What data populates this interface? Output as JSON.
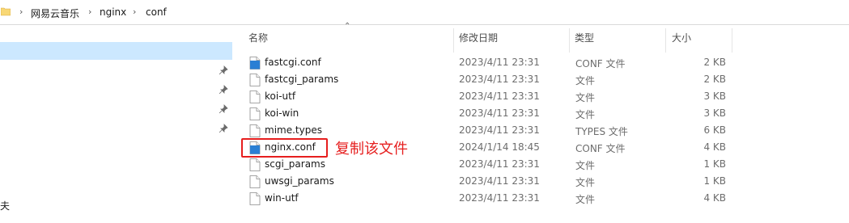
{
  "breadcrumb": {
    "items": [
      "网易云音乐",
      "nginx",
      "conf"
    ]
  },
  "nav": {
    "partial_label": "夫"
  },
  "columns": {
    "name": "名称",
    "modified": "修改日期",
    "type": "类型",
    "size": "大小"
  },
  "files": [
    {
      "name": "fastcgi.conf",
      "modified": "2023/4/11 23:31",
      "type": "CONF 文件",
      "size": "2 KB",
      "icon": "conf-file-icon"
    },
    {
      "name": "fastcgi_params",
      "modified": "2023/4/11 23:31",
      "type": "文件",
      "size": "2 KB",
      "icon": "blank-file-icon"
    },
    {
      "name": "koi-utf",
      "modified": "2023/4/11 23:31",
      "type": "文件",
      "size": "3 KB",
      "icon": "blank-file-icon"
    },
    {
      "name": "koi-win",
      "modified": "2023/4/11 23:31",
      "type": "文件",
      "size": "3 KB",
      "icon": "blank-file-icon"
    },
    {
      "name": "mime.types",
      "modified": "2023/4/11 23:31",
      "type": "TYPES 文件",
      "size": "6 KB",
      "icon": "blank-file-icon"
    },
    {
      "name": "nginx.conf",
      "modified": "2024/1/14 18:45",
      "type": "CONF 文件",
      "size": "4 KB",
      "icon": "conf-file-icon"
    },
    {
      "name": "scgi_params",
      "modified": "2023/4/11 23:31",
      "type": "文件",
      "size": "1 KB",
      "icon": "blank-file-icon"
    },
    {
      "name": "uwsgi_params",
      "modified": "2023/4/11 23:31",
      "type": "文件",
      "size": "1 KB",
      "icon": "blank-file-icon"
    },
    {
      "name": "win-utf",
      "modified": "2023/4/11 23:31",
      "type": "文件",
      "size": "4 KB",
      "icon": "blank-file-icon"
    }
  ],
  "annotation": {
    "text": "复制该文件",
    "color": "#e61e1e"
  },
  "colors": {
    "selection": "#cce8ff",
    "folder": "#f8d775",
    "conf_icon": "#2a7fd4"
  }
}
